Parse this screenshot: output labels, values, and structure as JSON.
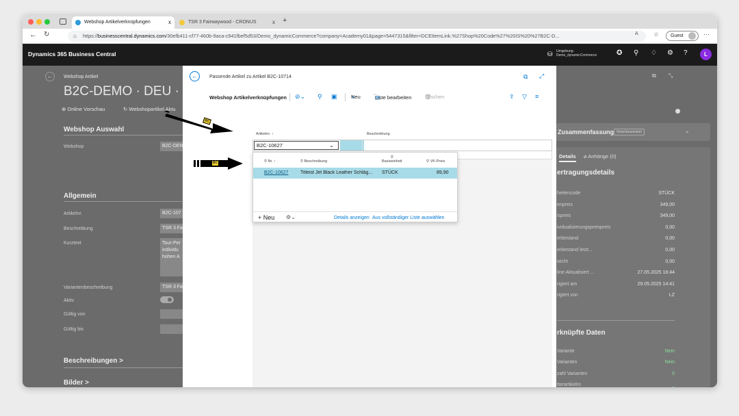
{
  "browser": {
    "tabs": [
      {
        "title": "Webshop Artikelverknüpfungen",
        "close": "x"
      },
      {
        "title": "TSR 3 Fairwaywood - CRONUS",
        "close": "x"
      }
    ],
    "new_tab": "+",
    "url_prefix": "https://",
    "url_domain": "businesscentral.dynamics.com",
    "url_rest": "/30efb411-cf77-460b-9aca-c941fbef5d53/Demo_dynamicCommerce?company=Academy01&page=5447315&filter=DCEItemLink.%27Shop%20Code%27%20IS%20%27B2C-D...",
    "guest_label": "Guest"
  },
  "header": {
    "app_title": "Dynamics 365 Business Central",
    "env_label": "Umgebung:",
    "env_value": "Demo_dynamicCommerce",
    "avatar": "L",
    "help": "?"
  },
  "bg_page": {
    "title_small": "Webshop Artikel",
    "title_big": "B2C-DEMO · DEU · B2C-",
    "actions": [
      "Online Vorschau",
      "Webshopartikel Aktu"
    ],
    "section_webshop": "Webshop Auswahl",
    "webshop_label": "Webshop",
    "webshop_value": "B2C-DEN",
    "section_allgemein": "Allgemein",
    "fields": [
      {
        "label": "Artikelnr.",
        "value": "B2C-107"
      },
      {
        "label": "Beschreibung",
        "value": "TSR 3 Fa"
      },
      {
        "label": "Kurztext",
        "value": "Tour-Per"
      }
    ],
    "kurztext_more": [
      "individu",
      "hohen A"
    ],
    "fields2": [
      {
        "label": "Variantenbeschreibung",
        "value": "TSR 3 Fa"
      },
      {
        "label": "Aktiv",
        "value": ""
      },
      {
        "label": "Gültig von",
        "value": ""
      },
      {
        "label": "Gültig bis",
        "value": ""
      }
    ],
    "section_beschreibungen": "Beschreibungen >",
    "section_bilder": "Bilder >"
  },
  "factbox": {
    "title": "Zusammenfassung",
    "badge": "Vorschauversion",
    "tab_details": "Details",
    "tab_anhaenge": "Anhänge (0)",
    "section1": "ertragungsdetails",
    "rows": [
      {
        "label": "heitencode",
        "value": "STÜCK"
      },
      {
        "label": "enpreis",
        "value": "349,00"
      },
      {
        "label": "ispreis",
        "value": "349,00"
      },
      {
        "label": "ividualisierungspreispreis",
        "value": "0,00"
      },
      {
        "label": "erbestand",
        "value": "0,00"
      },
      {
        "label": "erbestand letzt...",
        "value": "0,00"
      },
      {
        "label": "wicht",
        "value": "0,00"
      },
      {
        "label": "line Aktualisiert ...",
        "value": "27.05.2025 16:44"
      },
      {
        "label": "rigiert am",
        "value": "29.05.2025 14:41"
      },
      {
        "label": "rigiert von",
        "value": "LZ"
      }
    ],
    "section2": "rknüpfte Daten",
    "rows2": [
      {
        "label": "Variante",
        "value": "Nein"
      },
      {
        "label": "Varianten",
        "value": "Nein"
      },
      {
        "label": "zahl Varianten",
        "value": "0"
      },
      {
        "label": "tterartikelnr.",
        "value": "_"
      },
      {
        "label": "zahl Kategorien",
        "value": "2"
      }
    ]
  },
  "dialog": {
    "caption": "Passende Artikel zu Artikel B2C-10714",
    "list_title": "Webshop Artikelverknüpfungen",
    "new_label": "Neu",
    "edit_list_label": "Liste bearbeiten",
    "delete_label": "Löschen",
    "col_artikelnr": "Artikelnr. ↑",
    "col_beschreibung": "Beschreibung",
    "input_value": "B2C-10627",
    "lookup": {
      "col_nr": "Nr. ↑",
      "col_beschreibung": "Beschreibung",
      "col_basis": "Basiseinheit",
      "col_vk": "VK-Preis",
      "row": {
        "nr": "B2C-10627",
        "beschreibung": "Titleist Jet Black Leather Schläg...",
        "einheit": "STÜCK",
        "preis": "89,90"
      },
      "new_label": "Neu",
      "details_label": "Details anzeigen",
      "full_list_label": "Aus vollständiger Liste auswählen"
    }
  },
  "markers": {
    "text": "BC"
  },
  "colors": {
    "accent": "#0078d4",
    "selected_row": "#a7dbe7",
    "avatar": "#8a2ce0",
    "bc_header": "#1b1b1b"
  }
}
